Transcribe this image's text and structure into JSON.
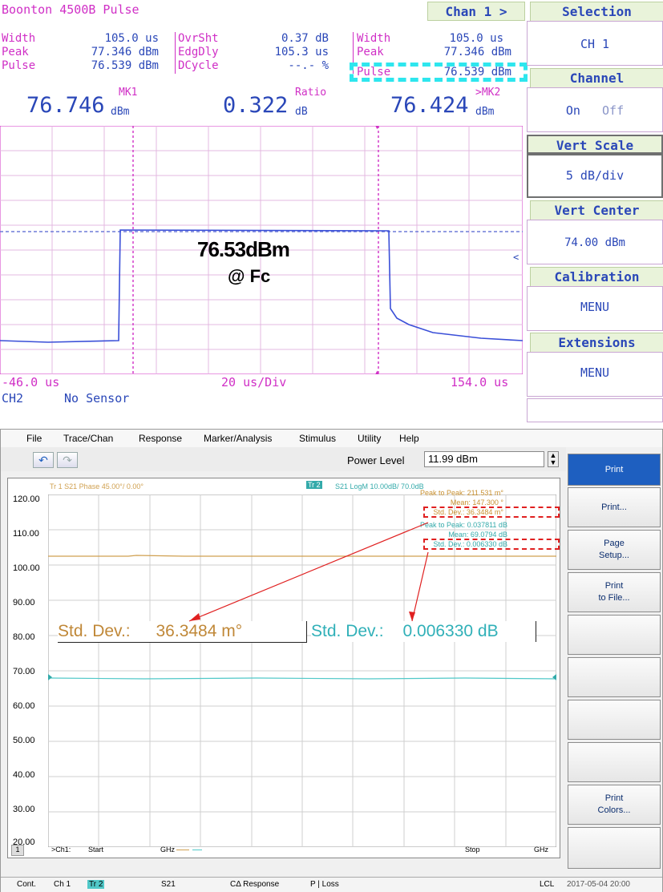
{
  "boonton": {
    "title": "Boonton 4500B Pulse",
    "chan_button": "Chan 1 >",
    "col1": [
      {
        "label": "Width",
        "value": "105.0 us"
      },
      {
        "label": "Peak",
        "value": "77.346 dBm"
      },
      {
        "label": "Pulse",
        "value": "76.539 dBm"
      }
    ],
    "col2": [
      {
        "label": "OvrSht",
        "value": "0.37 dB"
      },
      {
        "label": "EdgDly",
        "value": "105.3 us"
      },
      {
        "label": "DCycle",
        "value": "--.- %"
      }
    ],
    "col3": [
      {
        "label": "Width",
        "value": "105.0 us"
      },
      {
        "label": "Peak",
        "value": "77.346 dBm"
      },
      {
        "label": "Pulse",
        "value": "76.539 dBm"
      }
    ],
    "mk1": {
      "value": "76.746",
      "unit": "dBm",
      "tag": "MK1"
    },
    "ratio": {
      "value": "0.322",
      "unit": "dB",
      "tag": "Ratio"
    },
    "mk2": {
      "value": "76.424",
      "unit": "dBm",
      "tag": ">MK2"
    },
    "annotation_line1": "76.53dBm",
    "annotation_line2": "@ Fc",
    "x_left": "-46.0 us",
    "x_mid": "20 us/Div",
    "x_right": "154.0 us",
    "ch2_label": "CH2",
    "ch2_status": "No Sensor",
    "menu": {
      "selection_title": "Selection",
      "selection_value": "CH 1",
      "channel_title": "Channel",
      "channel_on": "On",
      "channel_off": "Off",
      "vert_scale_title": "Vert Scale",
      "vert_scale_value": "5 dB/div",
      "vert_center_title": "Vert Center",
      "vert_center_value": "74.00 dBm",
      "calibration_title": "Calibration",
      "calibration_value": "MENU",
      "extensions_title": "Extensions",
      "extensions_value": "MENU"
    },
    "colors": {
      "magenta": "#d02fc6",
      "blue": "#2a47b8",
      "cyan_highlight": "#2ee6ee"
    }
  },
  "vna": {
    "menu": [
      "File",
      "Trace/Chan",
      "Response",
      "Marker/Analysis",
      "Stimulus",
      "Utility",
      "Help"
    ],
    "power_level_label": "Power Level",
    "power_level_value": "11.99 dBm",
    "tr1_header": "Tr  1  S21 Phase 45.00°/  0.00°",
    "tr2_tag": "Tr 2",
    "tr2_header": "S21 LogM 10.00dB/  70.0dB",
    "y_labels": [
      "120.00",
      "110.00",
      "100.00",
      "90.00",
      "80.00",
      "70.00",
      "60.00",
      "50.00",
      "40.00",
      "30.00",
      "20.00"
    ],
    "stats_tr1": [
      {
        "label": "Peak to Peak:",
        "value": "211.531 m°"
      },
      {
        "label": "Mean:",
        "value": "147.300 °"
      },
      {
        "label": "Std. Dev.:",
        "value": "36.3484 m°"
      }
    ],
    "stats_tr2": [
      {
        "label": "Peak to Peak:",
        "value": "0.037811 dB"
      },
      {
        "label": "Mean:",
        "value": "69.0794 dB"
      },
      {
        "label": "Std. Dev.:",
        "value": "0.006330 dB"
      }
    ],
    "callout1": {
      "label": "Std. Dev.:",
      "value": "36.3484 m°"
    },
    "callout2": {
      "label": "Std. Dev.:",
      "value": "0.006330 dB"
    },
    "bottom_row": {
      "ch_index": "1",
      "ch": ">Ch1:",
      "start": "Start",
      "unit": "GHz",
      "stop": "Stop",
      "unit2": "GHz"
    },
    "softkeys": [
      {
        "line1": "Print",
        "line2": ""
      },
      {
        "line1": "Print...",
        "line2": ""
      },
      {
        "line1": "Page",
        "line2": "Setup..."
      },
      {
        "line1": "Print",
        "line2": "to File..."
      },
      {
        "line1": "",
        "line2": ""
      },
      {
        "line1": "",
        "line2": ""
      },
      {
        "line1": "",
        "line2": ""
      },
      {
        "line1": "",
        "line2": ""
      },
      {
        "line1": "Print",
        "line2": "Colors..."
      },
      {
        "line1": "",
        "line2": ""
      }
    ],
    "status": {
      "mode": "Cont.",
      "ch": "Ch 1",
      "tr": "Tr 2",
      "param": "S21",
      "resp": "CΔ Response",
      "loss": "P | Loss",
      "lcl": "LCL",
      "datetime": "2017-05-04 20:00"
    },
    "colors": {
      "tr1": "#d0a050",
      "tr2": "#50c8c8",
      "red": "#e02020"
    }
  }
}
